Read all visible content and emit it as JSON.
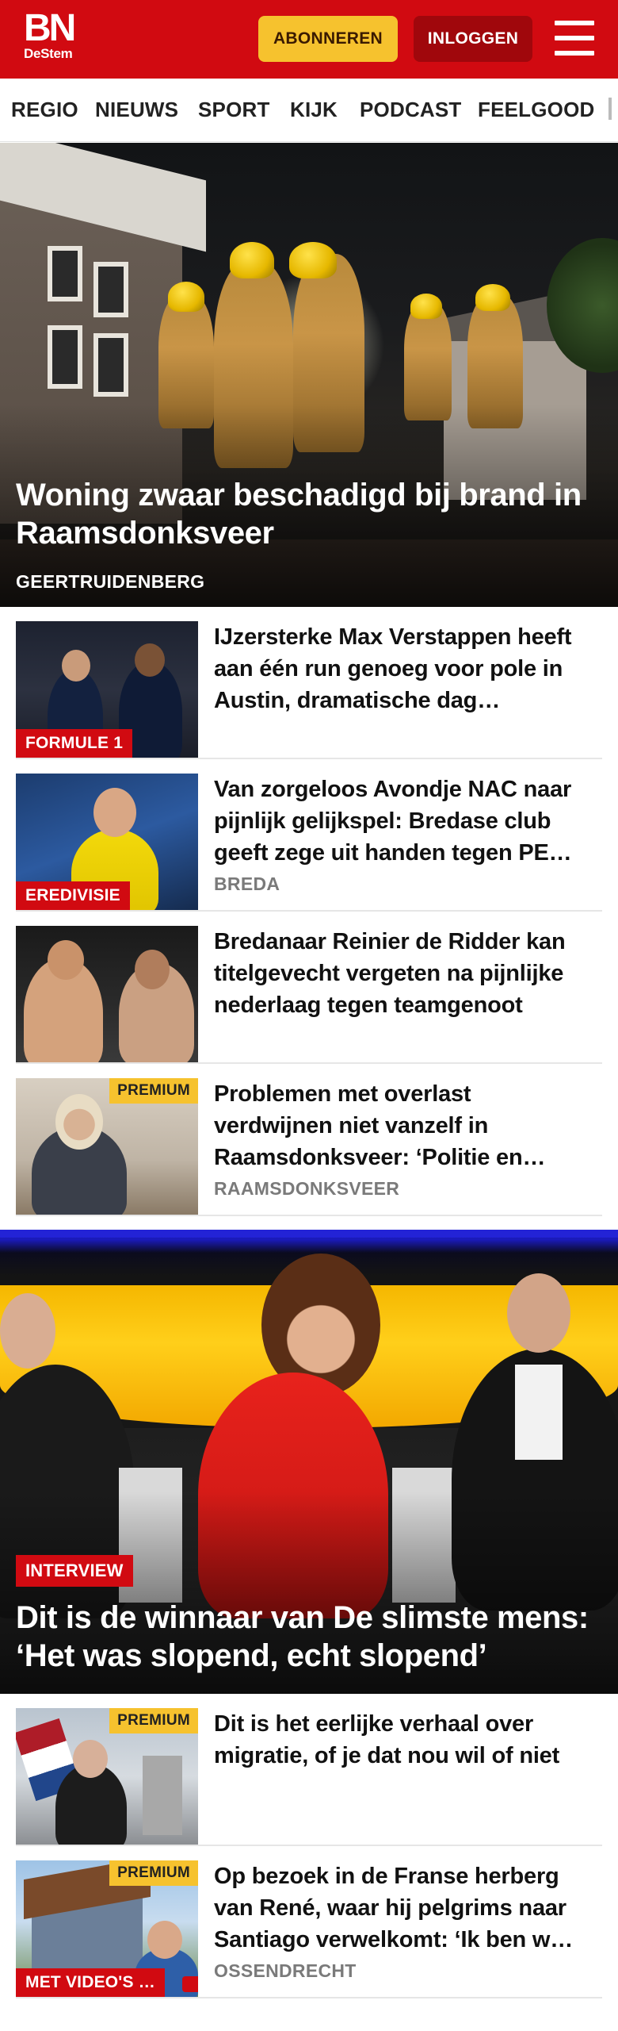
{
  "header": {
    "logo_main": "BN",
    "logo_sub": "DeStem",
    "subscribe_label": "ABONNEREN",
    "login_label": "INLOGGEN",
    "brand_color": "#d10a11",
    "subscribe_color": "#f6c22e"
  },
  "nav": {
    "items": [
      "REGIO",
      "NIEUWS",
      "SPORT",
      "KIJK",
      "PODCAST",
      "FEELGOOD"
    ]
  },
  "hero1": {
    "title": "Woning zwaar beschadigd bij brand in Raamsdonksveer",
    "meta": "GEERTRUIDENBERG"
  },
  "articles": [
    {
      "title": "IJzersterke Max Verstappen heeft aan één run genoeg voor pole in Austin, dramatische dag…",
      "tag": "FORMULE 1",
      "meta": "",
      "premium": ""
    },
    {
      "title": "Van zorgeloos Avondje NAC naar pijnlijk gelijkspel: Bredase club geeft zege uit handen tegen PE…",
      "tag": "EREDIVISIE",
      "meta": "BREDA",
      "premium": ""
    },
    {
      "title": "Bredanaar Reinier de Ridder kan titelgevecht vergeten na pijnlijke nederlaag tegen teamgenoot",
      "tag": "",
      "meta": "",
      "premium": ""
    },
    {
      "title": "Problemen met overlast verdwijnen niet vanzelf in Raamsdonksveer: ‘Politie en…",
      "tag": "",
      "meta": "RAAMSDONKSVEER",
      "premium": "PREMIUM"
    }
  ],
  "hero2": {
    "tag": "INTERVIEW",
    "title": "Dit is de winnaar van De slimste mens: ‘Het was slopend, echt slopend’"
  },
  "articles2": [
    {
      "title": "Dit is het eerlijke verhaal over migratie, of je dat nou wil of niet",
      "tag": "",
      "meta": "",
      "premium": "PREMIUM"
    },
    {
      "title": "Op bezoek in de Franse herberg van René, waar hij pelgrims naar Santiago verwelkomt: ‘Ik ben w…",
      "tag": "MET VIDEO'S …",
      "meta": "OSSENDRECHT",
      "premium": "PREMIUM"
    }
  ]
}
